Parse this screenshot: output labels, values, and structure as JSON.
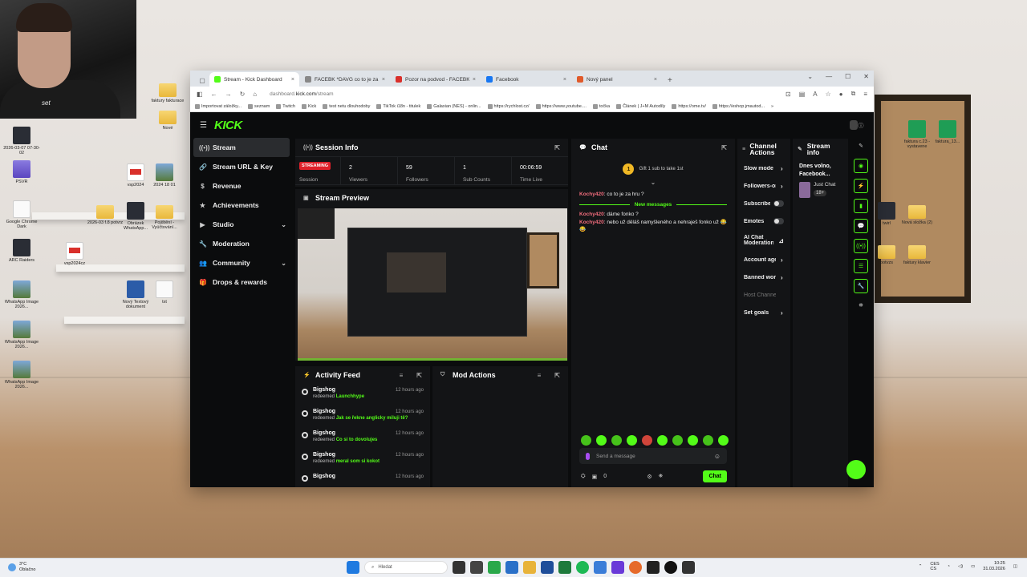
{
  "browser": {
    "tabs": [
      {
        "title": "Stream - Kick Dashboard",
        "fav": "#53fc18",
        "active": true
      },
      {
        "title": "FACEBK *DAVG co to je za trans...",
        "fav": "#888888",
        "active": false
      },
      {
        "title": "Pozor na podvod - FACEBK - Vi...",
        "fav": "#d9302b",
        "active": false
      },
      {
        "title": "Facebook",
        "fav": "#1877f2",
        "active": false
      },
      {
        "title": "Nový panel",
        "fav": "#e05a2b",
        "active": false
      }
    ],
    "url_host": "dashboard.",
    "url_bold": "kick.com",
    "url_path": "/stream",
    "bookmarks": [
      "Importovat záložky...",
      "seznam",
      "Twitch",
      "Kick",
      "test netu dlouhodoby",
      "TikTok i18n - titulek",
      "Galaxian (NES) - onlin...",
      "https://rychlost.cz/",
      "https://www.youtube....",
      "točka",
      "Článek | J+M Autodíly",
      "https://ome.tv/",
      "https://eshop.jmautod..."
    ]
  },
  "kick": {
    "logo": "KICK",
    "nav": [
      {
        "label": "Stream",
        "icon": "((•))",
        "active": true,
        "chev": false
      },
      {
        "label": "Stream URL & Key",
        "icon": "🔗",
        "active": false,
        "chev": false
      },
      {
        "label": "Revenue",
        "icon": "$",
        "active": false,
        "chev": false
      },
      {
        "label": "Achievements",
        "icon": "★",
        "active": false,
        "chev": false
      },
      {
        "label": "Studio",
        "icon": "▶",
        "active": false,
        "chev": true
      },
      {
        "label": "Moderation",
        "icon": "🔧",
        "active": false,
        "chev": false
      },
      {
        "label": "Community",
        "icon": "👥",
        "active": false,
        "chev": true
      },
      {
        "label": "Drops & rewards",
        "icon": "🎁",
        "active": false,
        "chev": false
      }
    ],
    "session": {
      "title": "Session Info",
      "badge": "STREAMING",
      "stats": [
        {
          "value": "",
          "label": "Session"
        },
        {
          "value": "2",
          "label": "Viewers"
        },
        {
          "value": "59",
          "label": "Followers"
        },
        {
          "value": "1",
          "label": "Sub Counts"
        },
        {
          "value": "00:06:59",
          "label": "Time Live"
        }
      ]
    },
    "preview_title": "Stream Preview",
    "activity": {
      "title": "Activity Feed",
      "items": [
        {
          "user": "Bigshog",
          "action": "redeemed",
          "reward": "Launchhype",
          "time": "12 hours ago"
        },
        {
          "user": "Bigshog",
          "action": "redeemed",
          "reward": "Jak se řekne anglicky miluji tě?",
          "time": "12 hours ago"
        },
        {
          "user": "Bigshog",
          "action": "redeemed",
          "reward": "Co si to dovolujes",
          "time": "12 hours ago"
        },
        {
          "user": "Bigshog",
          "action": "redeemed",
          "reward": "meral som si kokot",
          "time": "12 hours ago"
        },
        {
          "user": "Bigshog",
          "action": "",
          "reward": "",
          "time": "12 hours ago"
        }
      ]
    },
    "mod_actions_title": "Mod Actions",
    "chat": {
      "title": "Chat",
      "gift_text": "Gift 1 sub to take 1st",
      "gift_num": "1",
      "messages_before": [
        {
          "user": "Kochy420",
          "text": "co to je za hru ?"
        }
      ],
      "new_messages_label": "New messages",
      "messages_after": [
        {
          "user": "Kochy420",
          "text": "dáme fonko ?"
        },
        {
          "user": "Kochy420",
          "text": "nebo už děláš namyšleného a nehraješ fonko už 😂😂"
        }
      ],
      "placeholder": "Send a message",
      "points": "0",
      "send_label": "Chat"
    },
    "channel_actions": {
      "title": "Channel Actions",
      "items": [
        {
          "label": "Slow mode",
          "kind": "chev"
        },
        {
          "label": "Followers-only",
          "kind": "chev"
        },
        {
          "label": "Subscribers",
          "kind": "toggle"
        },
        {
          "label": "Emotes",
          "kind": "toggle"
        },
        {
          "label": "AI Chat Moderation",
          "kind": "ext"
        },
        {
          "label": "Account age",
          "kind": "chev"
        },
        {
          "label": "Banned words",
          "kind": "chev"
        },
        {
          "label": "Host Channel",
          "kind": "dim"
        },
        {
          "label": "Set goals",
          "kind": "chev"
        }
      ]
    },
    "stream_info": {
      "title": "Stream info",
      "stream_title": "Dnes volno, Facebook...",
      "category": "Just Chat",
      "rating": "18+"
    }
  },
  "desktop": {
    "webcam_tag": "set",
    "icons": [
      {
        "label": "2026-03-07 07-30-02",
        "type": "dark"
      },
      {
        "label": "PSVR",
        "type": "purple"
      },
      {
        "label": "Google Chrome Dark",
        "type": "white"
      },
      {
        "label": "ARC Raiders",
        "type": "dark"
      },
      {
        "label": "WhatsApp Image 2026...",
        "type": "img"
      },
      {
        "label": "WhatsApp Image 2026...",
        "type": "img"
      },
      {
        "label": "WhatsApp Image 2026...",
        "type": "img"
      },
      {
        "label": "faktury fakturace",
        "type": "folder"
      },
      {
        "label": "Nové",
        "type": "folder"
      },
      {
        "label": "vsp2024",
        "type": "pdf"
      },
      {
        "label": "2024 18 01",
        "type": "img"
      },
      {
        "label": "2026-03 f.8 potvrz",
        "type": "folder"
      },
      {
        "label": "Obrázek WhatsApp...",
        "type": "dark"
      },
      {
        "label": "Pojištění - Vyúčtování...",
        "type": "folder"
      },
      {
        "label": "vsp2024cz",
        "type": "pdf"
      },
      {
        "label": "Nový Textový dokument",
        "type": "doc"
      },
      {
        "label": "txt",
        "type": "white"
      },
      {
        "label": "faktura c.23 - vystavene",
        "type": "xls"
      },
      {
        "label": "faktura_13...",
        "type": "xls"
      },
      {
        "label": "twirl",
        "type": "dark"
      },
      {
        "label": "Nová složka (2)",
        "type": "folder"
      },
      {
        "label": "potvzs",
        "type": "folder"
      },
      {
        "label": "faktury klavier",
        "type": "folder"
      }
    ]
  },
  "taskbar": {
    "temp": "3°C",
    "weather": "Oblačno",
    "search": "Hledat",
    "lang1": "CES",
    "lang2": "CS",
    "time": "10:25",
    "date": "31.03.2026"
  }
}
